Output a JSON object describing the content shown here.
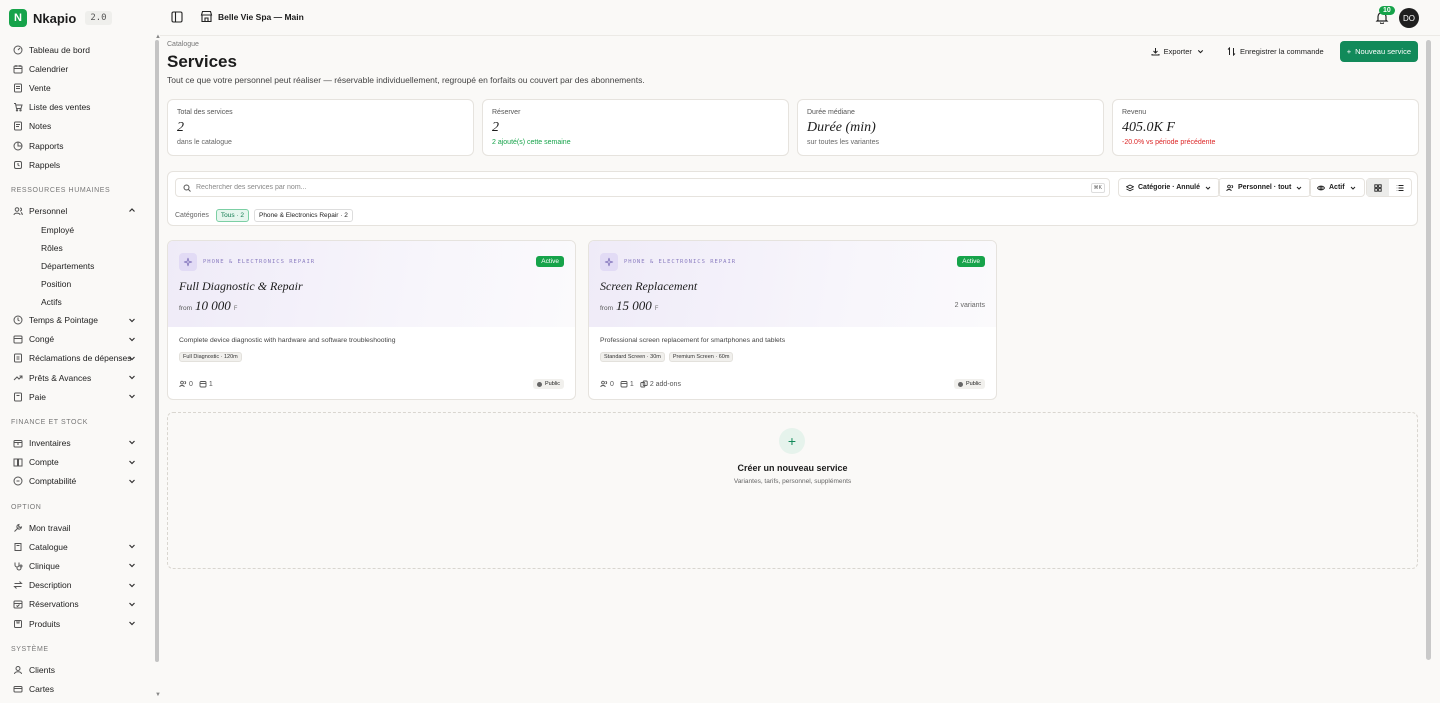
{
  "brand": {
    "logo": "N",
    "name": "Nkapio",
    "version": "2.0"
  },
  "topbar": {
    "store": "Belle Vie Spa — Main",
    "notif_count": "10",
    "avatar": "DO"
  },
  "sidebar": {
    "items_top": [
      {
        "label": "Tableau de bord",
        "icon": "gauge-icon"
      },
      {
        "label": "Calendrier",
        "icon": "calendar-icon"
      },
      {
        "label": "Vente",
        "icon": "receipt-icon"
      },
      {
        "label": "Liste des ventes",
        "icon": "cart-icon"
      },
      {
        "label": "Notes",
        "icon": "note-icon"
      },
      {
        "label": "Rapports",
        "icon": "chart-icon"
      },
      {
        "label": "Rappels",
        "icon": "reminder-icon"
      }
    ],
    "section_hr": "RESSOURCES HUMAINES",
    "personnel": "Personnel",
    "personnel_sub": [
      "Employé",
      "Rôles",
      "Départements",
      "Position",
      "Actifs"
    ],
    "items_hr": [
      "Temps & Pointage",
      "Congé",
      "Réclamations de dépenses",
      "Prêts & Avances",
      "Paie"
    ],
    "section_fin": "FINANCE ET STOCK",
    "items_fin": [
      "Inventaires",
      "Compte",
      "Comptabilité"
    ],
    "section_opt": "OPTION",
    "mon_travail": "Mon travail",
    "items_opt": [
      "Catalogue",
      "Clinique",
      "Description",
      "Réservations",
      "Produits"
    ],
    "section_sys": "SYSTÈME",
    "items_sys": [
      "Clients",
      "Cartes"
    ]
  },
  "page": {
    "breadcrumb": "Catalogue",
    "title": "Services",
    "description": "Tout ce que votre personnel peut réaliser — réservable individuellement, regroupé en forfaits ou couvert par des abonnements.",
    "actions": {
      "export": "Exporter",
      "save_order": "Enregistrer la commande",
      "new_service": "Nouveau service"
    }
  },
  "stats": [
    {
      "label": "Total des services",
      "value": "2",
      "sub": "dans le catalogue"
    },
    {
      "label": "Réserver",
      "value": "2",
      "sub": "2 ajouté(s) cette semaine"
    },
    {
      "label": "Durée médiane",
      "value": "Durée (min)",
      "sub": "sur toutes les variantes"
    },
    {
      "label": "Revenu",
      "value": "405.0K F",
      "sub": "-20.0% vs période précédente"
    }
  ],
  "filters": {
    "search_placeholder": "Rechercher des services par nom...",
    "kbd": "⌘K",
    "category": "Catégorie · Annulé",
    "staff": "Personnel · tout",
    "status": "Actif",
    "cats_label": "Catégories",
    "chip_all": "Tous · 2",
    "chip_phone": "Phone & Electronics Repair · 2"
  },
  "cards": [
    {
      "category": "PHONE & ELECTRONICS REPAIR",
      "status": "Active",
      "title": "Full Diagnostic & Repair",
      "from": "from",
      "price": "10 000",
      "currency": "F",
      "variants": "",
      "description": "Complete device diagnostic with hardware and software troubleshooting",
      "tags": [
        "Full Diagnostic · 120m"
      ],
      "staff_count": "0",
      "resource_count": "1",
      "addons": "",
      "visibility": "Public"
    },
    {
      "category": "PHONE & ELECTRONICS REPAIR",
      "status": "Active",
      "title": "Screen Replacement",
      "from": "from",
      "price": "15 000",
      "currency": "F",
      "variants": "2 variants",
      "description": "Professional screen replacement for smartphones and tablets",
      "tags": [
        "Standard Screen · 30m",
        "Premium Screen · 60m"
      ],
      "staff_count": "0",
      "resource_count": "1",
      "addons": "2 add-ons",
      "visibility": "Public"
    }
  ],
  "create": {
    "title": "Créer un nouveau service",
    "subtitle": "Variantes, tarifs, personnel, suppléments"
  },
  "colors": {
    "accent": "#128a5a",
    "active_badge": "#16a34a",
    "negative": "#dc2626",
    "category": "#8a7cc0"
  }
}
